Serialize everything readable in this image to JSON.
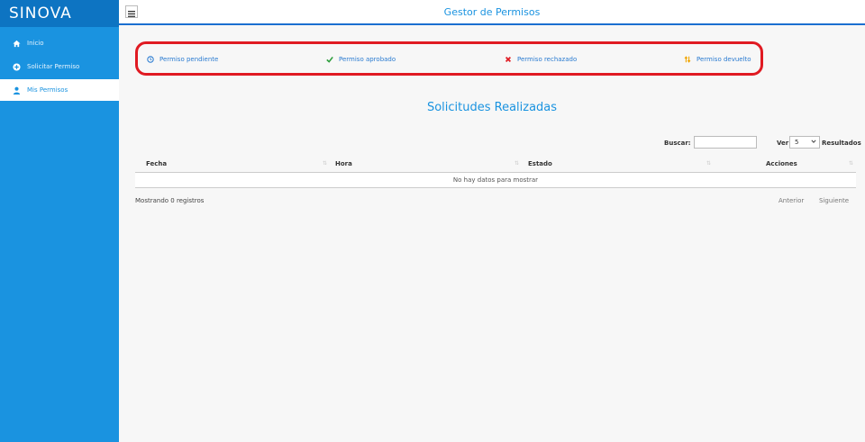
{
  "sidebar": {
    "brand": "SINOVA",
    "items": [
      {
        "label": "Inicio",
        "icon": "home-icon"
      },
      {
        "label": "Solicitar Permiso",
        "icon": "plus-circle-icon"
      },
      {
        "label": "Mis Permisos",
        "icon": "user-icon"
      }
    ],
    "active_item": "Mis Permisos"
  },
  "header": {
    "title": "Gestor de Permisos",
    "menu_icon": "hamburger-icon"
  },
  "legend": {
    "items": [
      {
        "label": "Permiso pendiente",
        "icon": "clock-icon",
        "color": "#2a7bd1"
      },
      {
        "label": "Permiso aprobado",
        "icon": "check-icon",
        "color": "#2e9e3d"
      },
      {
        "label": "Permiso rechazado",
        "icon": "x-icon",
        "color": "#e01a22"
      },
      {
        "label": "Permiso devuelto",
        "icon": "swap-arrows-icon",
        "color": "#f0a500"
      }
    ]
  },
  "main": {
    "section_title": "Solicitudes Realizadas",
    "search_label": "Buscar:",
    "search_value": "",
    "ver_label": "Ver",
    "page_size": "5",
    "results_label": "Resultados",
    "table": {
      "columns": [
        "Fecha",
        "Hora",
        "Estado",
        "Acciones"
      ],
      "empty_message": "No hay datos para mostrar"
    },
    "info_text": "Mostrando 0 registros",
    "prev_label": "Anterior",
    "next_label": "Siguiente"
  },
  "colors": {
    "sidebar": "#1a93e0",
    "brand_bg": "#0d74c2",
    "accent": "#1a93e0",
    "highlight_border": "#e01a22"
  }
}
